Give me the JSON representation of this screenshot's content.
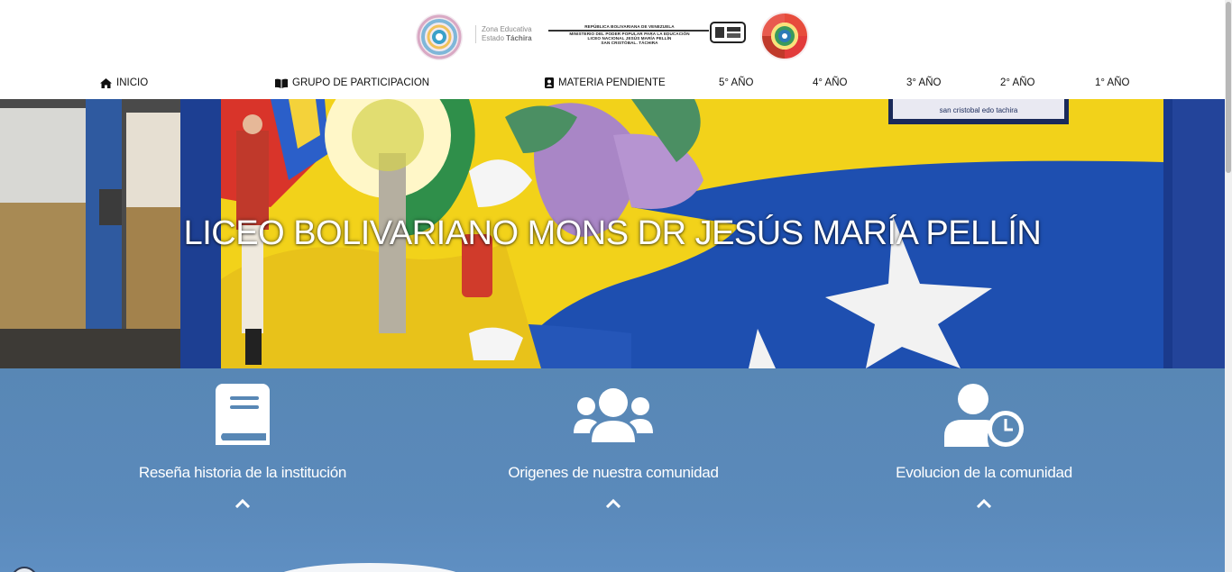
{
  "header": {
    "zona_line1": "Zona Educativa",
    "zona_line2_prefix": "Estado ",
    "zona_line2_bold": "Táchira",
    "ministry_line1": "REPÚBLICA BOLIVARIANA DE VENEZUELA",
    "ministry_line2": "MINISTERIO DEL PODER POPULAR PARA LA EDUCACIÓN",
    "ministry_line3": "LICEO NACIONAL JESÚS MARÍA PELLÍN",
    "ministry_line4": "SAN CRISTÓBAL. TÁCHIRA",
    "logo_left_icon": "education-zone-logo",
    "logo_right_icon": "school-emblem-logo",
    "seal_icon": "school-seal-icon"
  },
  "nav": {
    "items": [
      {
        "label": "INICIO",
        "icon": "home-icon"
      },
      {
        "label": "GRUPO DE PARTICIPACION",
        "icon": "book-open-icon"
      },
      {
        "label": "MATERIA PENDIENTE",
        "icon": "address-book-icon"
      },
      {
        "label": "5° AÑO"
      },
      {
        "label": "4° AÑO"
      },
      {
        "label": "3° AÑO"
      },
      {
        "label": "2° AÑO"
      },
      {
        "label": "1° AÑO"
      }
    ]
  },
  "hero": {
    "title": "LICEO BOLIVARIANO MONS DR JESÚS MARÍA PELLÍN",
    "plaque_text": "san cristobal edo tachira"
  },
  "features": [
    {
      "label": "Reseña historia de la institución",
      "icon": "book-icon"
    },
    {
      "label": "Origenes de nuestra comunidad",
      "icon": "users-icon"
    },
    {
      "label": "Evolucion de la comunidad",
      "icon": "user-clock-icon"
    }
  ],
  "colors": {
    "features_bg": "#5887b5",
    "hero_text": "#ffffff",
    "nav_text": "#111111"
  }
}
